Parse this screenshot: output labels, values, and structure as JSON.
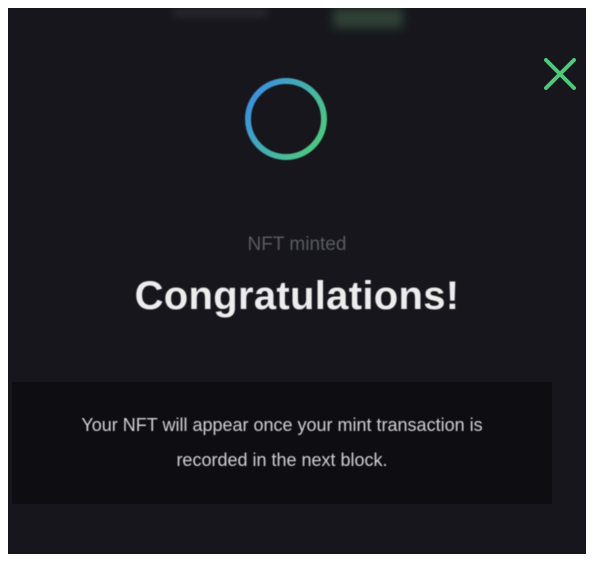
{
  "modal": {
    "close_icon": "close-icon",
    "status_icon": "loading-ring-icon",
    "subtitle": "NFT minted",
    "headline": "Congratulations!",
    "message": "Your NFT will appear once your mint transaction is recorded in the next block."
  },
  "colors": {
    "background": "#16161c",
    "notice_background": "#0d0d12",
    "accent_green": "#4ec97a",
    "accent_blue": "#3b8fe0",
    "headline_text": "#ededed",
    "subtitle_text": "#5b5b64",
    "body_text": "#d2d2d6"
  }
}
